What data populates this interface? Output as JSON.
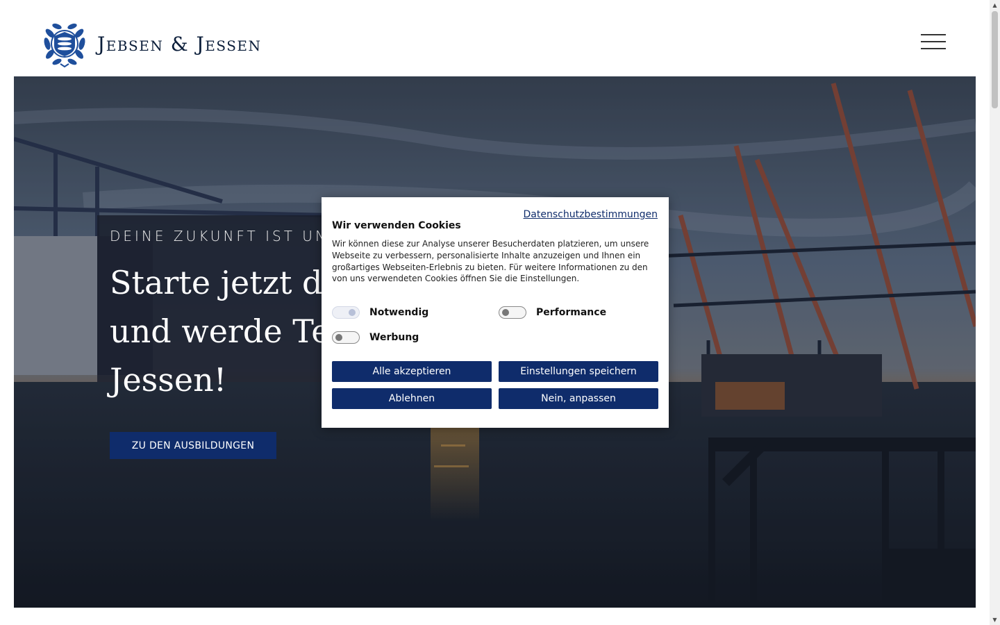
{
  "header": {
    "logo_text": "Jebsen & Jessen"
  },
  "hero": {
    "kicker": "DEINE ZUKUNFT IST UNS",
    "title_lines": [
      "Starte jetzt de",
      "und werde Tei",
      "Jessen!"
    ],
    "cta_label": "ZU DEN AUSBILDUNGEN"
  },
  "cookie": {
    "privacy_link": "Datenschutzbestimmungen",
    "title": "Wir verwenden Cookies",
    "text": "Wir können diese zur Analyse unserer Besucherdaten platzieren, um unsere Webseite zu verbessern, personalisierte Inhalte anzuzeigen und Ihnen ein großartiges Webseiten-Erlebnis zu bieten. Für weitere Informationen zu den von uns verwendeten Cookies öffnen Sie die Einstellungen.",
    "toggles": [
      {
        "label": "Notwendig",
        "state": "on-disabled"
      },
      {
        "label": "Performance",
        "state": "off"
      },
      {
        "label": "Werbung",
        "state": "off"
      }
    ],
    "buttons": {
      "accept_all": "Alle akzeptieren",
      "save_settings": "Einstellungen speichern",
      "decline": "Ablehnen",
      "customize": "Nein, anpassen"
    }
  },
  "colors": {
    "brand_navy": "#0f2c6b",
    "logo_blue": "#1f4f9c"
  }
}
